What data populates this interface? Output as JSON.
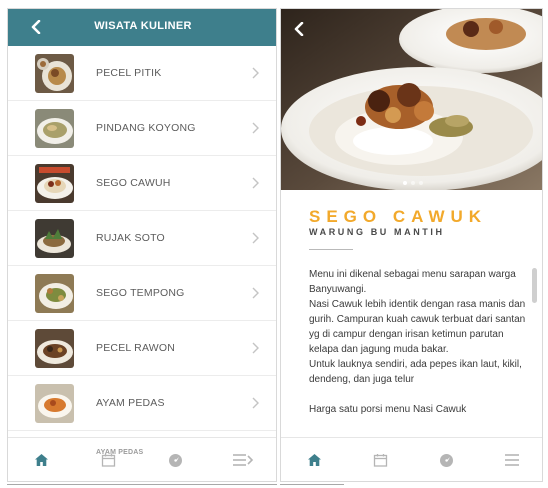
{
  "left_screen": {
    "header_title": "WISATA KULINER",
    "menu_items": [
      {
        "label": "PECEL PITIK"
      },
      {
        "label": "PINDANG KOYONG"
      },
      {
        "label": "SEGO CAWUH"
      },
      {
        "label": "RUJAK SOTO"
      },
      {
        "label": "SEGO TEMPONG"
      },
      {
        "label": "PECEL RAWON"
      },
      {
        "label": "AYAM PEDAS"
      }
    ],
    "ghost_label": "AYAM PEDAS"
  },
  "right_screen": {
    "title": "SEGO CAWUK",
    "subtitle": "WARUNG BU MANTIH",
    "description": [
      "Menu ini dikenal sebagai menu sarapan warga Banyuwangi.",
      "Nasi Cawuk lebih identik dengan rasa manis dan gurih. Campuran kuah cawuk terbuat dari santan yg di campur dengan irisan ketimun parutan kelapa dan jagung muda bakar.",
      "Untuk lauknya sendiri, ada pepes ikan laut, kikil, dendeng, dan juga telur",
      "",
      "Harga satu porsi menu Nasi Cawuk"
    ]
  },
  "tabs": [
    "home-icon",
    "calendar-icon",
    "compass-icon",
    "menu-icon"
  ],
  "colors": {
    "header": "#3e7f8c",
    "active_tab": "#3e7f8c",
    "inactive_tab": "#b5b5b5",
    "title_accent": "#f2a92b"
  }
}
